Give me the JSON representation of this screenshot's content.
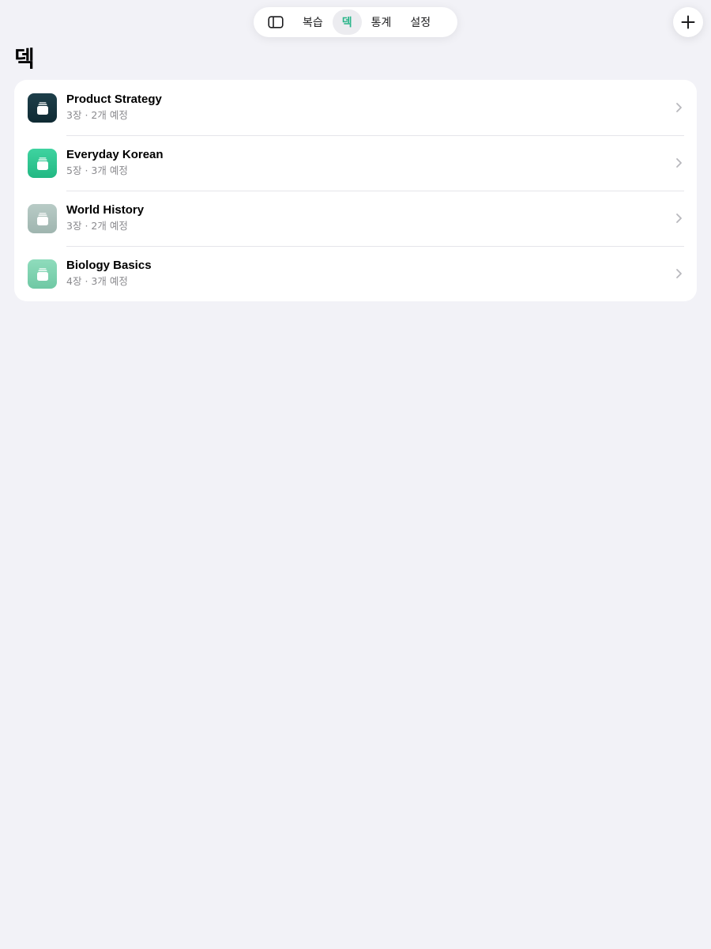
{
  "tabbar": {
    "sidebar_icon": "sidebar-toggle-icon",
    "tabs": [
      {
        "label": "복습",
        "active": false
      },
      {
        "label": "덱",
        "active": true
      },
      {
        "label": "통계",
        "active": false
      },
      {
        "label": "설정",
        "active": false
      }
    ]
  },
  "add_button": {
    "icon": "plus-icon"
  },
  "page": {
    "title": "덱"
  },
  "decks": [
    {
      "name": "Product Strategy",
      "cards": "3장",
      "separator": "·",
      "due": "2개 예정",
      "icon": "deck-stack-icon",
      "color": "#15333d"
    },
    {
      "name": "Everyday Korean",
      "cards": "5장",
      "separator": "·",
      "due": "3개 예정",
      "icon": "deck-stack-icon",
      "color": "#2cc48f"
    },
    {
      "name": "World History",
      "cards": "3장",
      "separator": "·",
      "due": "2개 예정",
      "icon": "deck-stack-icon",
      "color": "#a9bfba"
    },
    {
      "name": "Biology Basics",
      "cards": "4장",
      "separator": "·",
      "due": "3개 예정",
      "icon": "deck-stack-icon",
      "color": "#7fd3b1"
    }
  ],
  "colors": {
    "accent": "#2ab58a",
    "background": "#f2f2f7",
    "card": "#ffffff",
    "secondary_text": "#8a8a8e"
  }
}
